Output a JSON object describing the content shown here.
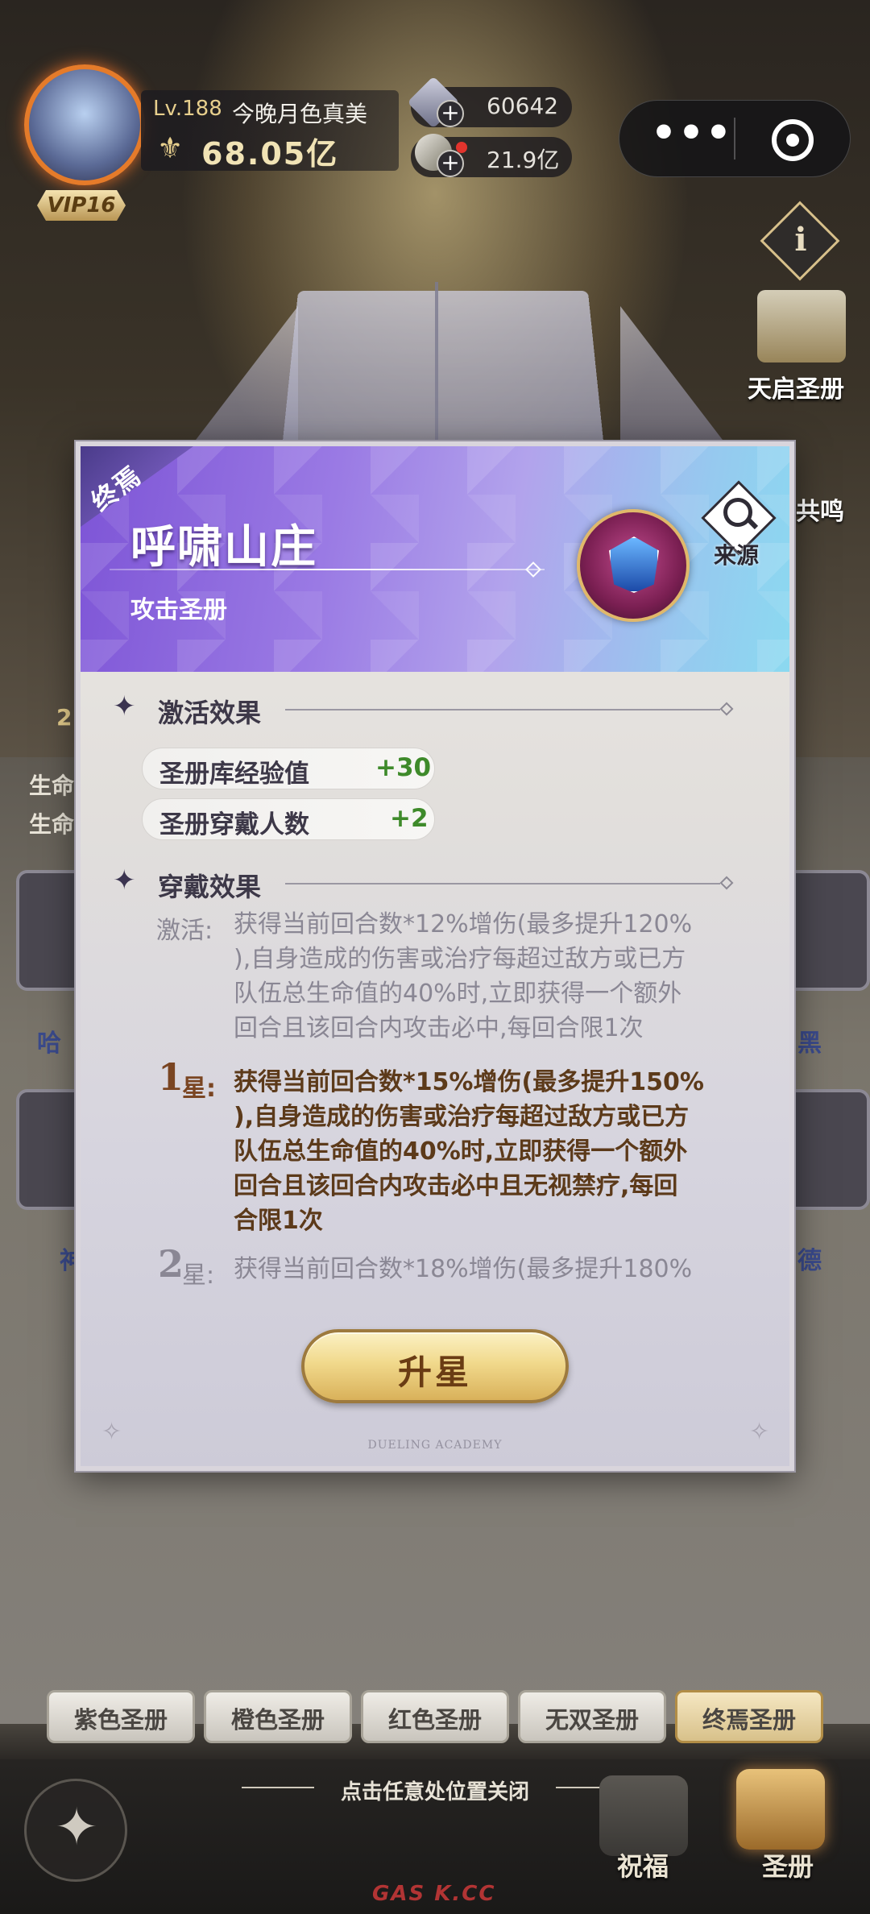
{
  "player": {
    "level_label": "Lv.188",
    "name": "今晚月色真美",
    "power": "68.05亿",
    "vip": "VIP16"
  },
  "resources": [
    {
      "icon": "diamond-icon",
      "value": "60642"
    },
    {
      "icon": "coin-icon",
      "value": "21.9亿"
    }
  ],
  "side_menu": {
    "book_label": "天启圣册",
    "resonance_label": "共鸣"
  },
  "modal": {
    "ribbon": "终焉",
    "title": "呼啸山庄",
    "subtitle": "攻击圣册",
    "source_label": "来源",
    "activation_section": "激活效果",
    "stats": [
      {
        "label": "圣册库经验值",
        "value": "+30"
      },
      {
        "label": "圣册穿戴人数",
        "value": "+2"
      }
    ],
    "wear_section": "穿戴效果",
    "effects": {
      "activate_key": "激活:",
      "activate_lines": [
        "获得当前回合数*12%增伤(最多提升120%",
        "),自身造成的伤害或治疗每超过敌方或已方",
        "队伍总生命值的40%时,立即获得一个额外",
        "回合且该回合内攻击必中,每回合限1次"
      ],
      "star1_num": "1",
      "star1_word": "星:",
      "star1_lines": [
        "获得当前回合数*15%增伤(最多提升150%",
        "),自身造成的伤害或治疗每超过敌方或已方",
        "队伍总生命值的40%时,立即获得一个额外",
        "回合且该回合内攻击必中且无视禁疗,每回",
        "合限1次"
      ],
      "star2_num": "2",
      "star2_word": "星:",
      "star2_line": "获得当前回合数*18%增伤(最多提升180%"
    },
    "upgrade_button": "升星",
    "footer_brand": "DUELING ACADEMY"
  },
  "tabs": [
    {
      "label": "紫色圣册",
      "active": false
    },
    {
      "label": "橙色圣册",
      "active": false
    },
    {
      "label": "红色圣册",
      "active": false
    },
    {
      "label": "无双圣册",
      "active": false
    },
    {
      "label": "终焉圣册",
      "active": true
    }
  ],
  "bottom": {
    "close_hint": "点击任意处位置关闭",
    "bless_label": "祝福",
    "book_label": "圣册",
    "watermark": "GAS K.CC"
  },
  "behind": {
    "left_life_1": "生命",
    "left_life_2": "生命",
    "left_name_1": "哈",
    "left_name_2": "神",
    "right_name_1": "黑",
    "right_name_2": "德",
    "left_num": "2"
  },
  "colors": {
    "accent_gold": "#e7cf8d",
    "stat_green": "#3e8a2a",
    "active_effect_brown": "#5c3a1a",
    "header_purple": "#7d54d6",
    "header_cyan": "#8bd9f0"
  }
}
